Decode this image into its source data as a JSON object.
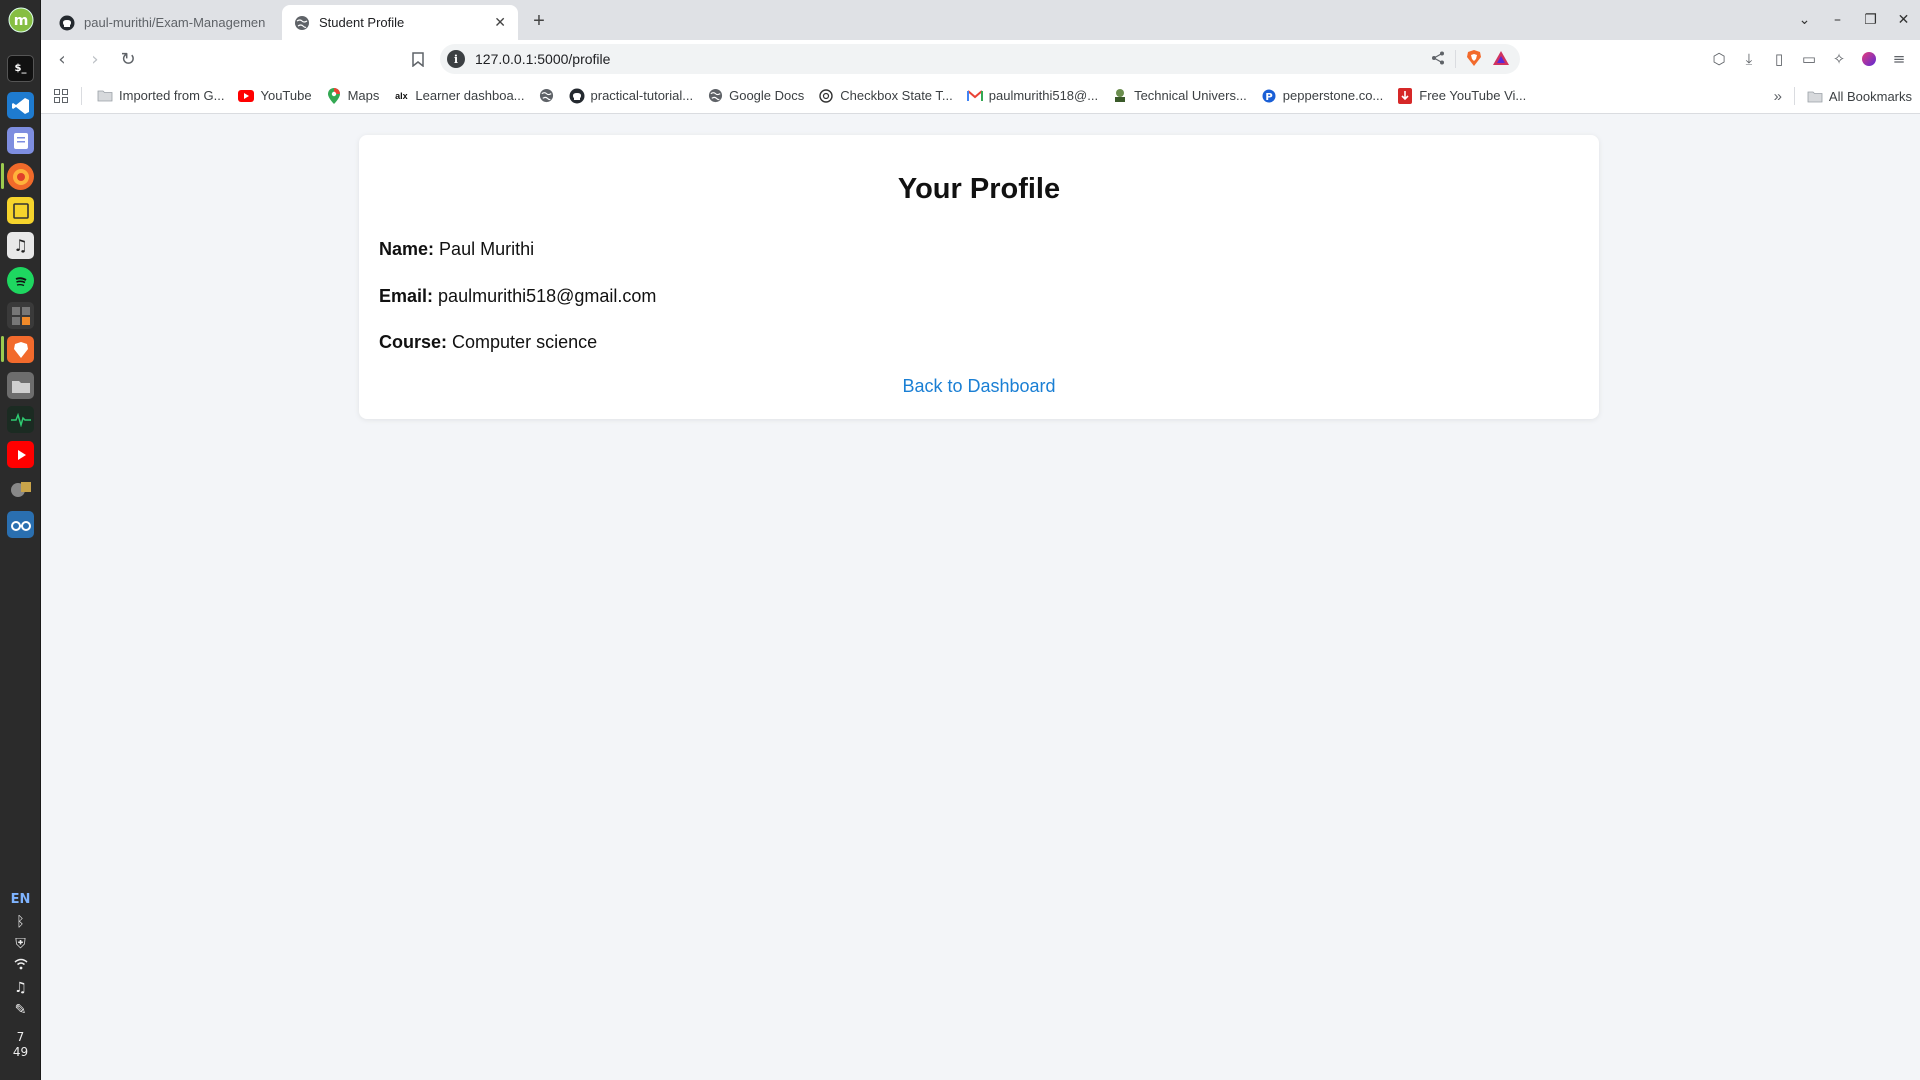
{
  "tabs": [
    {
      "title": "paul-murithi/Exam-Management",
      "active": false,
      "icon": "github-icon"
    },
    {
      "title": "Student Profile",
      "active": true,
      "icon": "globe-icon"
    }
  ],
  "address_bar": {
    "url": "127.0.0.1:5000/profile"
  },
  "bookmarks": [
    {
      "label": "Imported from G...",
      "icon": "folder-icon"
    },
    {
      "label": "YouTube",
      "icon": "youtube-icon"
    },
    {
      "label": "Maps",
      "icon": "maps-pin-icon"
    },
    {
      "label": "Learner dashboa...",
      "icon": "alx-icon"
    },
    {
      "label": "",
      "icon": "globe-icon"
    },
    {
      "label": "practical-tutorial...",
      "icon": "github-icon"
    },
    {
      "label": "Google Docs",
      "icon": "globe-icon"
    },
    {
      "label": "Checkbox State T...",
      "icon": "openai-icon"
    },
    {
      "label": "paulmurithi518@...",
      "icon": "gmail-icon"
    },
    {
      "label": "Technical Univers...",
      "icon": "university-icon"
    },
    {
      "label": "pepperstone.co...",
      "icon": "pepperstone-icon"
    },
    {
      "label": "Free YouTube Vi...",
      "icon": "download-icon"
    }
  ],
  "bookmarks_more": "»",
  "all_bookmarks": "All Bookmarks",
  "profile": {
    "heading": "Your Profile",
    "name_label": "Name:",
    "name_value": "Paul Murithi",
    "email_label": "Email:",
    "email_value": "paulmurithi518@gmail.com",
    "course_label": "Course:",
    "course_value": "Computer science",
    "back_link": "Back to Dashboard"
  },
  "system_tray": {
    "language": "EN",
    "clock_hour": "7",
    "clock_minute": "49"
  },
  "colors": {
    "link": "#1a7fd4",
    "page_background": "#f3f5f8",
    "card_background": "#ffffff"
  }
}
